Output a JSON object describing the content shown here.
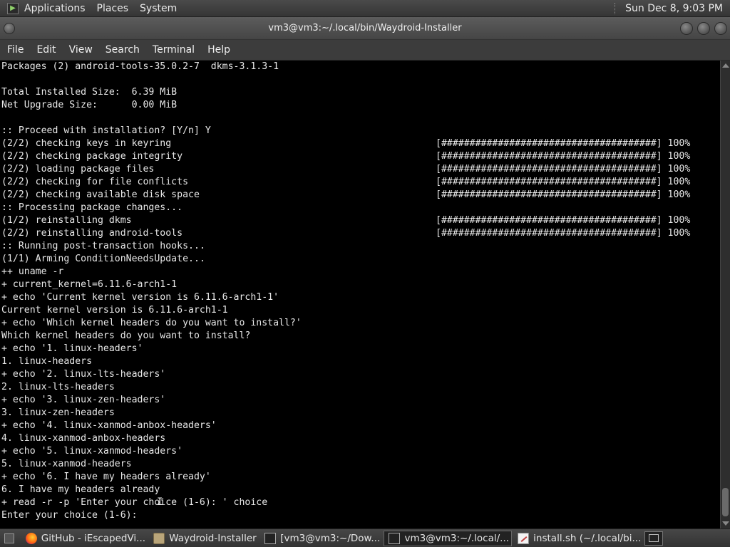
{
  "top_panel": {
    "menus": [
      "Applications",
      "Places",
      "System"
    ],
    "clock": "Sun Dec 8,  9:03 PM"
  },
  "window": {
    "title": "vm3@vm3:~/.local/bin/Waydroid-Installer"
  },
  "menubar": [
    "File",
    "Edit",
    "View",
    "Search",
    "Terminal",
    "Help"
  ],
  "terminal": {
    "lines": [
      {
        "text": "Packages (2) android-tools-35.0.2-7  dkms-3.1.3-1",
        "right": ""
      },
      {
        "text": "",
        "right": ""
      },
      {
        "text": "Total Installed Size:  6.39 MiB",
        "right": ""
      },
      {
        "text": "Net Upgrade Size:      0.00 MiB",
        "right": ""
      },
      {
        "text": "",
        "right": ""
      },
      {
        "text": ":: Proceed with installation? [Y/n] Y",
        "right": ""
      },
      {
        "text": "(2/2) checking keys in keyring",
        "right": "[######################################] 100%"
      },
      {
        "text": "(2/2) checking package integrity",
        "right": "[######################################] 100%"
      },
      {
        "text": "(2/2) loading package files",
        "right": "[######################################] 100%"
      },
      {
        "text": "(2/2) checking for file conflicts",
        "right": "[######################################] 100%"
      },
      {
        "text": "(2/2) checking available disk space",
        "right": "[######################################] 100%"
      },
      {
        "text": ":: Processing package changes...",
        "right": ""
      },
      {
        "text": "(1/2) reinstalling dkms",
        "right": "[######################################] 100%"
      },
      {
        "text": "(2/2) reinstalling android-tools",
        "right": "[######################################] 100%"
      },
      {
        "text": ":: Running post-transaction hooks...",
        "right": ""
      },
      {
        "text": "(1/1) Arming ConditionNeedsUpdate...",
        "right": ""
      },
      {
        "text": "++ uname -r",
        "right": ""
      },
      {
        "text": "+ current_kernel=6.11.6-arch1-1",
        "right": ""
      },
      {
        "text": "+ echo 'Current kernel version is 6.11.6-arch1-1'",
        "right": ""
      },
      {
        "text": "Current kernel version is 6.11.6-arch1-1",
        "right": ""
      },
      {
        "text": "+ echo 'Which kernel headers do you want to install?'",
        "right": ""
      },
      {
        "text": "Which kernel headers do you want to install?",
        "right": ""
      },
      {
        "text": "+ echo '1. linux-headers'",
        "right": ""
      },
      {
        "text": "1. linux-headers",
        "right": ""
      },
      {
        "text": "+ echo '2. linux-lts-headers'",
        "right": ""
      },
      {
        "text": "2. linux-lts-headers",
        "right": ""
      },
      {
        "text": "+ echo '3. linux-zen-headers'",
        "right": ""
      },
      {
        "text": "3. linux-zen-headers",
        "right": ""
      },
      {
        "text": "+ echo '4. linux-xanmod-anbox-headers'",
        "right": ""
      },
      {
        "text": "4. linux-xanmod-anbox-headers",
        "right": ""
      },
      {
        "text": "+ echo '5. linux-xanmod-headers'",
        "right": ""
      },
      {
        "text": "5. linux-xanmod-headers",
        "right": ""
      },
      {
        "text": "+ echo '6. I have my headers already'",
        "right": ""
      },
      {
        "text": "6. I have my headers already",
        "right": ""
      },
      {
        "text": "+ read -r -p 'Enter your choice (1-6): ' choice",
        "right": ""
      },
      {
        "text": "Enter your choice (1-6):",
        "right": ""
      }
    ]
  },
  "taskbar": {
    "tasks": [
      {
        "label": "GitHub - iEscapedVi...",
        "icon": "firefox-icon",
        "active": false
      },
      {
        "label": "Waydroid-Installer",
        "icon": "folder-icon",
        "active": false
      },
      {
        "label": "[vm3@vm3:~/Dow...",
        "icon": "terminal-icon",
        "active": false
      },
      {
        "label": "vm3@vm3:~/.local/...",
        "icon": "terminal-icon",
        "active": true
      },
      {
        "label": "install.sh (~/.local/bi...",
        "icon": "text-editor-icon",
        "active": false
      }
    ]
  },
  "colors": {
    "terminal_bg": "#000000",
    "terminal_fg": "#e8e8e8",
    "panel_bg": "#3c3c3c"
  }
}
